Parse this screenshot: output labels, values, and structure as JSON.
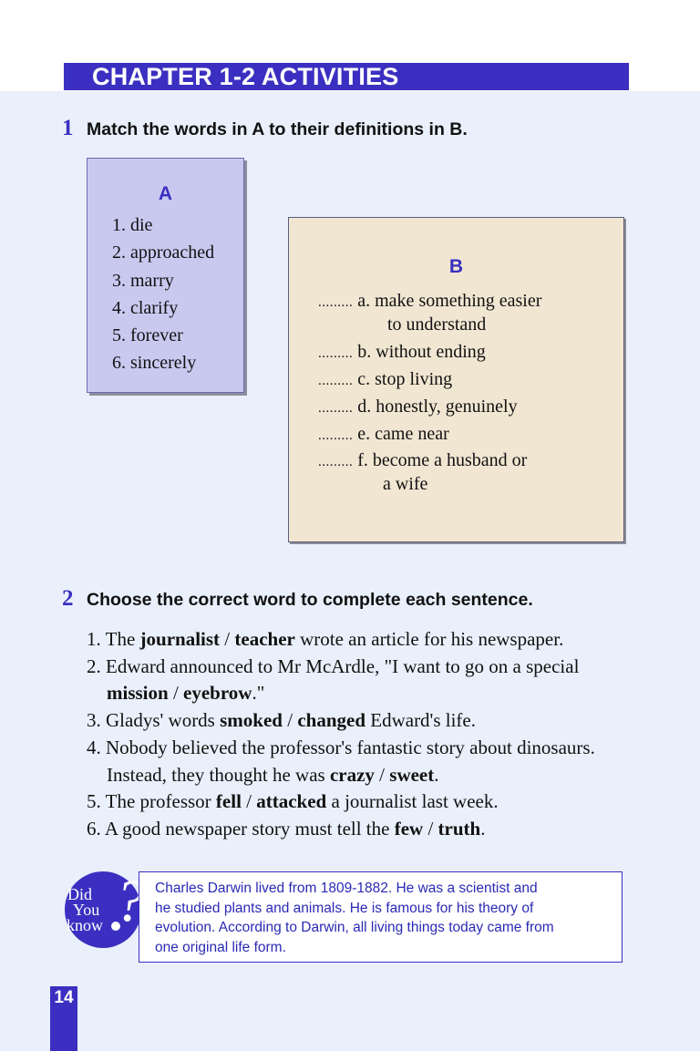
{
  "header": {
    "title": "CHAPTER 1-2 ACTIVITIES"
  },
  "exercise1": {
    "number": "1",
    "instruction": "Match the words in A to their definitions in B.",
    "column_a": {
      "heading": "A",
      "items": [
        "1. die",
        "2. approached",
        "3. marry",
        "4. clarify",
        "5. forever",
        "6. sincerely"
      ]
    },
    "column_b": {
      "heading": "B",
      "items": [
        {
          "dots": ".........",
          "text": "a. make something easier",
          "cont": "to understand"
        },
        {
          "dots": ".........",
          "text": "b. without ending"
        },
        {
          "dots": ".........",
          "text": "c. stop living"
        },
        {
          "dots": ".........",
          "text": "d. honestly, genuinely"
        },
        {
          "dots": ".........",
          "text": "e. came near"
        },
        {
          "dots": ".........",
          "text": "f. become a husband or",
          "cont": "a wife"
        }
      ]
    }
  },
  "exercise2": {
    "number": "2",
    "instruction": "Choose the correct word to complete each sentence.",
    "sentences": [
      {
        "pre": "1. The ",
        "opt1": "journalist",
        "sep": " / ",
        "opt2": "teacher",
        "post": " wrote an article for his newspaper."
      },
      {
        "pre": "2. Edward announced to Mr McArdle, \"I want to go on a special"
      },
      {
        "indent": true,
        "pre": "",
        "opt1": "mission",
        "sep": " / ",
        "opt2": "eyebrow",
        "post": ".\""
      },
      {
        "pre": "3. Gladys' words ",
        "opt1": "smoked",
        "sep": " / ",
        "opt2": "changed",
        "post": " Edward's life."
      },
      {
        "pre": "4. Nobody believed the professor's fantastic story about dinosaurs."
      },
      {
        "indent": true,
        "pre": "Instead, they thought he was ",
        "opt1": "crazy",
        "sep": " / ",
        "opt2": "sweet",
        "post": "."
      },
      {
        "pre": "5. The professor ",
        "opt1": "fell",
        "sep": " / ",
        "opt2": "attacked",
        "post": " a journalist last week."
      },
      {
        "pre": "6. A good newspaper story must tell the ",
        "opt1": "few",
        "sep": " / ",
        "opt2": "truth",
        "post": "."
      }
    ]
  },
  "did_you_know": {
    "badge_lines": [
      "Did",
      "You",
      "know"
    ],
    "lines": [
      "Charles Darwin lived from 1809-1882. He was a scientist and",
      "he studied plants and animals. He is famous for his theory of",
      "evolution. According to Darwin, all living things today came from",
      "one original life form."
    ]
  },
  "page_number": "14",
  "colors": {
    "accent": "#3a2fc0",
    "box_a": "#c9c9f0",
    "box_b": "#f1e6d2",
    "background": "#e9f0fb"
  }
}
